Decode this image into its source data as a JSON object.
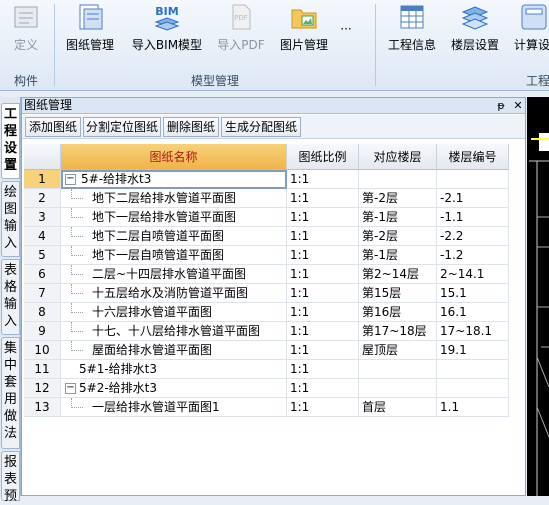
{
  "ribbon": {
    "groups": [
      {
        "label": "构件"
      },
      {
        "label": "模型管理"
      },
      {
        "label": "工程"
      }
    ],
    "buttons": {
      "define": "定义",
      "drawing_mgmt": "图纸管理",
      "import_bim": "导入BIM模型",
      "import_pdf": "导入PDF",
      "image_mgmt": "图片管理",
      "more": "···",
      "project_info": "工程信息",
      "floor_settings": "楼层设置",
      "calc_settings": "计算设"
    },
    "bim_icon_text": "BIM",
    "pdf_icon_text": "PDF"
  },
  "side_tabs": [
    "工程设置",
    "绘图输入",
    "表格输入",
    "集中套用做法",
    "报表预"
  ],
  "panel": {
    "title": "图纸管理",
    "pin": "ᵽ",
    "close": "✕",
    "toolbar": [
      "添加图纸",
      "分割定位图纸",
      "删除图纸",
      "生成分配图纸"
    ],
    "columns": [
      "图纸名称",
      "图纸比例",
      "对应楼层",
      "楼层编号"
    ],
    "rows": [
      {
        "no": "1",
        "name": "5#-给排水t3",
        "scale": "1:1",
        "floor": "",
        "code": ""
      },
      {
        "no": "2",
        "name": "地下二层给排水管道平面图",
        "scale": "1:1",
        "floor": "第-2层",
        "code": "-2.1"
      },
      {
        "no": "3",
        "name": "地下一层给排水管道平面图",
        "scale": "1:1",
        "floor": "第-1层",
        "code": "-1.1"
      },
      {
        "no": "4",
        "name": "地下二层自喷管道平面图",
        "scale": "1:1",
        "floor": "第-2层",
        "code": "-2.2"
      },
      {
        "no": "5",
        "name": "地下一层自喷管道平面图",
        "scale": "1:1",
        "floor": "第-1层",
        "code": "-1.2"
      },
      {
        "no": "6",
        "name": "二层~十四层排水管道平面图",
        "scale": "1:1",
        "floor": "第2~14层",
        "code": "2~14.1"
      },
      {
        "no": "7",
        "name": "十五层给水及消防管道平面图",
        "scale": "1:1",
        "floor": "第15层",
        "code": "15.1"
      },
      {
        "no": "8",
        "name": "十六层排水管道平面图",
        "scale": "1:1",
        "floor": "第16层",
        "code": "16.1"
      },
      {
        "no": "9",
        "name": "十七、十八层给排水管道平面图",
        "scale": "1:1",
        "floor": "第17~18层",
        "code": "17~18.1"
      },
      {
        "no": "10",
        "name": "屋面给排水管道平面图",
        "scale": "1:1",
        "floor": "屋顶层",
        "code": "19.1"
      },
      {
        "no": "11",
        "name": "5#1-给排水t3",
        "scale": "1:1",
        "floor": "",
        "code": ""
      },
      {
        "no": "12",
        "name": "5#2-给排水t3",
        "scale": "1:1",
        "floor": "",
        "code": ""
      },
      {
        "no": "13",
        "name": "一层给排水管道平面图1",
        "scale": "1:1",
        "floor": "首层",
        "code": "1.1"
      }
    ],
    "tree_toggle": "−"
  }
}
